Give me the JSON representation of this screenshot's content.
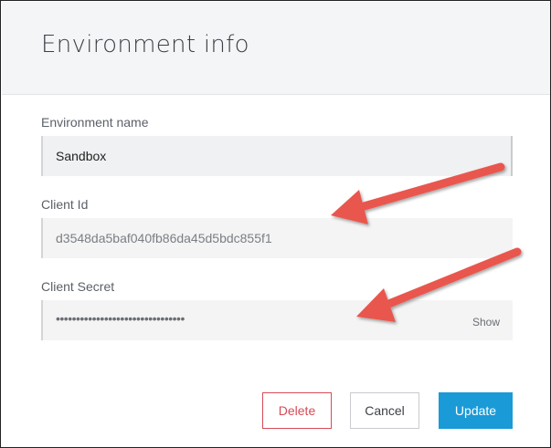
{
  "dialog": {
    "title": "Environment info"
  },
  "form": {
    "environment_name": {
      "label": "Environment name",
      "value": "Sandbox"
    },
    "client_id": {
      "label": "Client Id",
      "value": "d3548da5baf040fb86da45d5bdc855f1"
    },
    "client_secret": {
      "label": "Client Secret",
      "masked_value": "••••••••••••••••••••••••••••••••",
      "show_label": "Show"
    }
  },
  "buttons": {
    "delete": "Delete",
    "cancel": "Cancel",
    "update": "Update"
  },
  "annotations": {
    "arrow_color": "#e9564d"
  }
}
